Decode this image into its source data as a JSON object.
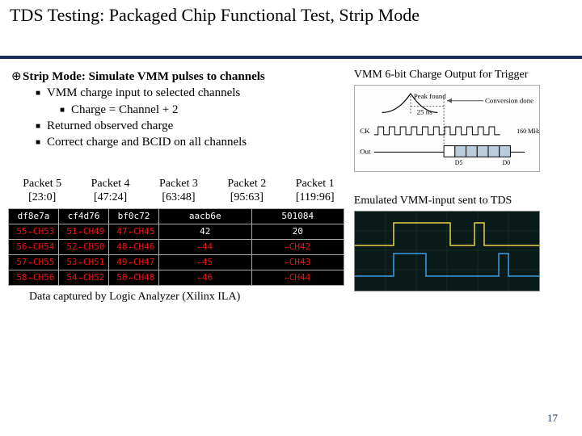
{
  "title": "TDS Testing: Packaged Chip Functional Test, Strip Mode",
  "bullets": {
    "b1": "Strip Mode: Simulate VMM pulses to channels",
    "b2a": "VMM charge input to selected channels",
    "b3a": "Charge = Channel + 2",
    "b2b": "Returned observed charge",
    "b2c": "Correct charge and BCID on all channels"
  },
  "right": {
    "h1": "VMM 6-bit Charge Output for Trigger",
    "h2": "Emulated VMM-input sent to TDS"
  },
  "fig1": {
    "peak": "Peak found",
    "ns": "25 ns",
    "conv": "Conversion done",
    "ck": "CK",
    "out": "Out",
    "mhz": "160 MHz",
    "d5": "D5",
    "d0": "D0"
  },
  "packets": {
    "headers": [
      {
        "name": "Packet 5",
        "bits": "[23:0]"
      },
      {
        "name": "Packet 4",
        "bits": "[47:24]"
      },
      {
        "name": "Packet 3",
        "bits": "[63:48]"
      },
      {
        "name": "Packet 2",
        "bits": "[95:63]"
      },
      {
        "name": "Packet 1",
        "bits": "[119:96]"
      }
    ]
  },
  "logic": {
    "hex": [
      "df8e7a",
      "cf4d76",
      "bf0c72",
      "aacb6e",
      "501084"
    ],
    "rows": [
      {
        "c": [
          [
            "55",
            "CH53"
          ],
          [
            "51",
            "CH49"
          ],
          [
            "47",
            "CH45"
          ],
          [
            "42",
            ""
          ],
          [
            "20",
            ""
          ]
        ]
      },
      {
        "c": [
          [
            "56",
            "CH54"
          ],
          [
            "52",
            "CH50"
          ],
          [
            "48",
            "CH46"
          ],
          [
            "44",
            ""
          ],
          [
            "CH42",
            ""
          ]
        ],
        "arrow4": true
      },
      {
        "c": [
          [
            "57",
            "CH55"
          ],
          [
            "53",
            "CH51"
          ],
          [
            "49",
            "CH47"
          ],
          [
            "45",
            ""
          ],
          [
            "CH43",
            ""
          ]
        ],
        "arrow4": true
      },
      {
        "c": [
          [
            "58",
            "CH56"
          ],
          [
            "54",
            "CH52"
          ],
          [
            "50",
            "CH48"
          ],
          [
            "46",
            ""
          ],
          [
            "CH44",
            ""
          ]
        ],
        "arrow4": true
      }
    ]
  },
  "caption": "Data captured by Logic Analyzer (Xilinx ILA)",
  "pagenum": "17"
}
